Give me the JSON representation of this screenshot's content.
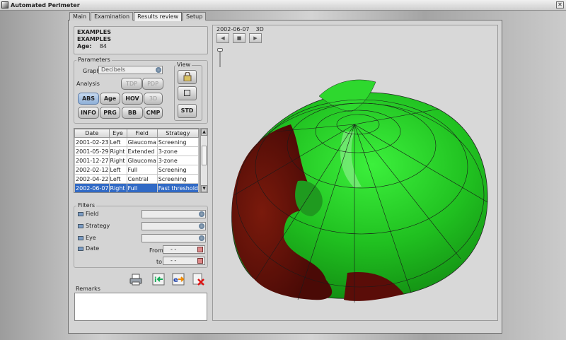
{
  "app_title": "Automated Perimeter",
  "tabs": [
    "Main",
    "Examination",
    "Results review",
    "Setup"
  ],
  "patient": {
    "line1": "EXAMPLES",
    "line2": "EXAMPLES",
    "age_label": "Age:",
    "age_value": "84"
  },
  "parameters": {
    "legend": "Parameters",
    "graph_label": "Graph",
    "graph_value": "Decibels",
    "analysis_label": "Analysis",
    "analysis_buttons": [
      "TDP",
      "PDP"
    ],
    "buttons_row1": [
      "ABS",
      "Age",
      "HOV",
      "3D"
    ],
    "buttons_row2": [
      "INFO",
      "PRG",
      "BB",
      "CMP"
    ],
    "view_legend": "View",
    "std_label": "STD"
  },
  "table": {
    "headers": [
      "Date",
      "Eye",
      "Field",
      "Strategy"
    ],
    "rows": [
      [
        "2001-02-23",
        "Left",
        "Glaucoma",
        "Screening"
      ],
      [
        "2001-05-29",
        "Right",
        "Extended",
        "3-zone"
      ],
      [
        "2001-12-27",
        "Right",
        "Glaucoma",
        "3-zone"
      ],
      [
        "2002-02-12",
        "Left",
        "Full",
        "Screening"
      ],
      [
        "2002-04-22",
        "Left",
        "Central",
        "Screening"
      ],
      [
        "2002-06-07",
        "Right",
        "Full",
        "Fast threshold"
      ]
    ],
    "selected_index": 5
  },
  "filters": {
    "legend": "Filters",
    "field_label": "Field",
    "strategy_label": "Strategy",
    "eye_label": "Eye",
    "date_label": "Date",
    "from_label": "From",
    "to_label": "to",
    "from_value": "- -",
    "to_value": "- -"
  },
  "remarks_label": "Remarks",
  "viewer": {
    "date": "2002-06-07",
    "mode": "3D"
  },
  "icons": [
    "printer-icon",
    "import-icon",
    "export-icon",
    "delete-icon",
    "lock-icon"
  ]
}
